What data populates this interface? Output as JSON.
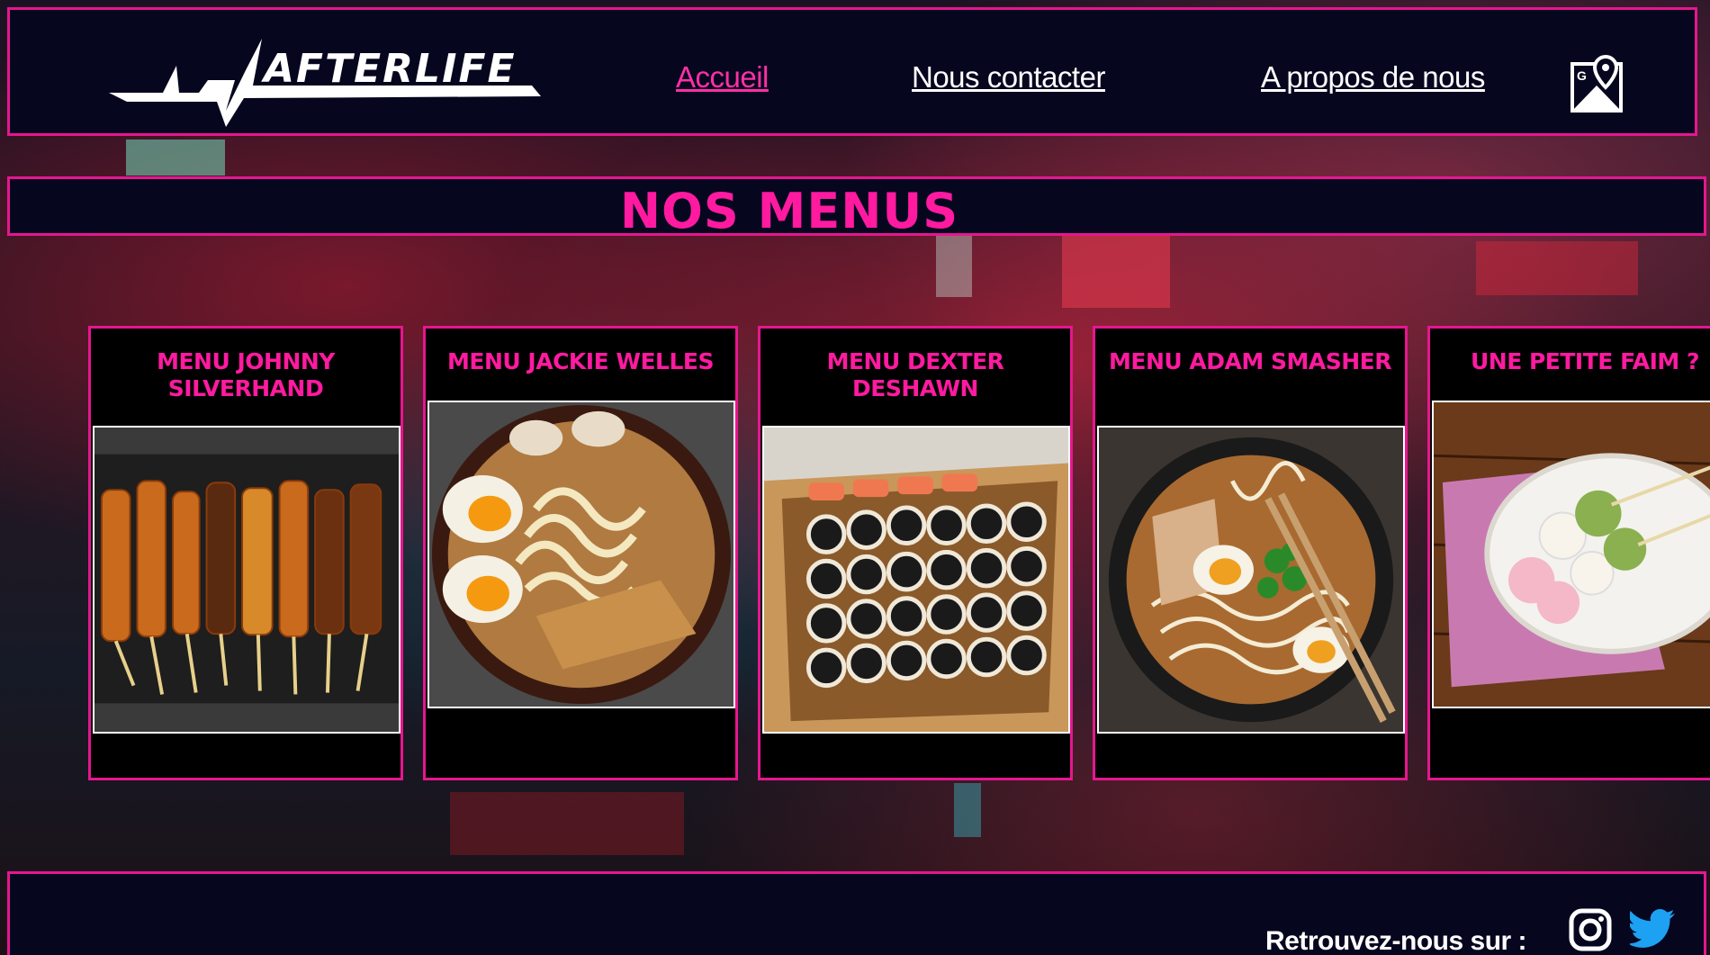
{
  "header": {
    "logo_alt": "AFTERLIFE",
    "nav": [
      {
        "label": "Accueil",
        "active": true
      },
      {
        "label": "Nous contacter",
        "active": false
      },
      {
        "label": "A propos de nous",
        "active": false
      }
    ],
    "map_icon": "google-maps-icon"
  },
  "main": {
    "title": "NOS MENUS",
    "cards": [
      {
        "title": "MENU JOHNNY SILVERHAND",
        "image": "yakitori-skewers"
      },
      {
        "title": "MENU JACKIE WELLES",
        "image": "udon-bowl"
      },
      {
        "title": "MENU DEXTER DESHAWN",
        "image": "sushi-boat"
      },
      {
        "title": "MENU ADAM SMASHER",
        "image": "ramen-bowl"
      },
      {
        "title": "UNE PETITE FAIM ?",
        "image": "dango-plate"
      }
    ]
  },
  "footer": {
    "text": "Retrouvez-nous sur :",
    "icons": [
      "instagram-icon",
      "twitter-icon"
    ]
  },
  "colors": {
    "accent": "#e6168f",
    "title_pink": "#ff1aa0",
    "panel": "#06061f"
  }
}
